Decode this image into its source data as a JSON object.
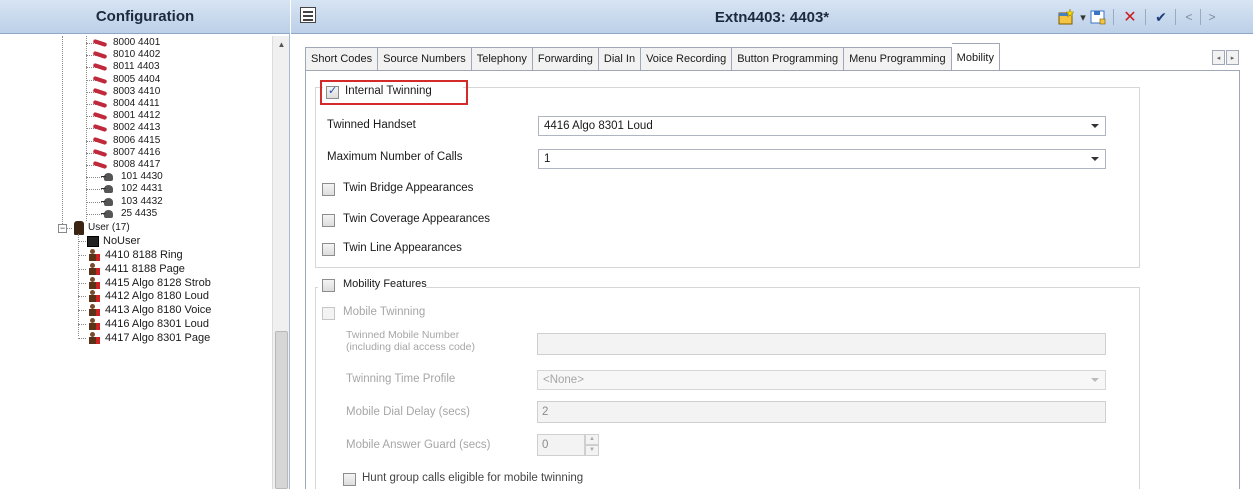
{
  "left_panel": {
    "title": "Configuration",
    "extensions": [
      {
        "label": "8000 4401",
        "type": "digital"
      },
      {
        "label": "8010 4402",
        "type": "digital"
      },
      {
        "label": "8011 4403",
        "type": "digital"
      },
      {
        "label": "8005 4404",
        "type": "digital"
      },
      {
        "label": "8003 4410",
        "type": "digital"
      },
      {
        "label": "8004 4411",
        "type": "digital"
      },
      {
        "label": "8001 4412",
        "type": "digital"
      },
      {
        "label": "8002 4413",
        "type": "digital"
      },
      {
        "label": "8006 4415",
        "type": "digital"
      },
      {
        "label": "8007 4416",
        "type": "digital"
      },
      {
        "label": "8008 4417",
        "type": "digital"
      },
      {
        "label": "101 4430",
        "type": "analog"
      },
      {
        "label": "102 4431",
        "type": "analog"
      },
      {
        "label": "103 4432",
        "type": "analog"
      },
      {
        "label": "25 4435",
        "type": "analog"
      }
    ],
    "user_group": {
      "label": "User (17)",
      "expander": "−"
    },
    "users": [
      {
        "label": "NoUser",
        "type": "nouser"
      },
      {
        "label": "4410 8188 Ring",
        "type": "user"
      },
      {
        "label": "4411 8188 Page",
        "type": "user"
      },
      {
        "label": "4415 Algo 8128 Strob",
        "type": "user"
      },
      {
        "label": "4412 Algo 8180 Loud",
        "type": "user"
      },
      {
        "label": "4413 Algo 8180 Voice",
        "type": "user"
      },
      {
        "label": "4416 Algo 8301 Loud",
        "type": "user"
      },
      {
        "label": "4417 Algo 8301 Page",
        "type": "user"
      }
    ]
  },
  "right_panel": {
    "title": "Extn4403: 4403*",
    "toolbar": {
      "new_icon": "new-window-icon",
      "dropdown_glyph": "▾",
      "save_icon": "save-icon",
      "cancel_glyph": "✕",
      "ok_glyph": "✔",
      "prev_glyph": "<",
      "next_glyph": ">"
    },
    "tabs": [
      {
        "label": "Short Codes"
      },
      {
        "label": "Source Numbers"
      },
      {
        "label": "Telephony"
      },
      {
        "label": "Forwarding"
      },
      {
        "label": "Dial In"
      },
      {
        "label": "Voice Recording"
      },
      {
        "label": "Button Programming"
      },
      {
        "label": "Menu Programming"
      },
      {
        "label": "Mobility",
        "active": true
      }
    ],
    "tab_scroll": {
      "left": "◂",
      "right": "▸"
    },
    "internal_twinning": {
      "label": "Internal Twinning",
      "checked": true,
      "twinned_handset_label": "Twinned Handset",
      "twinned_handset_value": "4416 Algo 8301 Loud",
      "max_calls_label": "Maximum Number of Calls",
      "max_calls_value": "1",
      "twin_bridge_label": "Twin Bridge Appearances",
      "twin_coverage_label": "Twin Coverage Appearances",
      "twin_line_label": "Twin Line Appearances"
    },
    "mobility_features": {
      "label": "Mobility Features",
      "mobile_twinning_label": "Mobile Twinning",
      "twinned_mobile_number_label_1": "Twinned Mobile Number",
      "twinned_mobile_number_label_2": "(including dial access code)",
      "twinned_mobile_number_value": "",
      "twinning_time_profile_label": "Twinning Time Profile",
      "twinning_time_profile_value": "<None>",
      "mobile_dial_delay_label": "Mobile Dial Delay (secs)",
      "mobile_dial_delay_value": "2",
      "mobile_answer_guard_label": "Mobile Answer Guard (secs)",
      "mobile_answer_guard_value": "0",
      "hunt_group_label": "Hunt group calls eligible for mobile twinning"
    },
    "colors": {
      "highlight_border": "#d42a2a",
      "header_gradient_top": "#d7e4f3",
      "header_gradient_bottom": "#bcd0e8"
    }
  }
}
